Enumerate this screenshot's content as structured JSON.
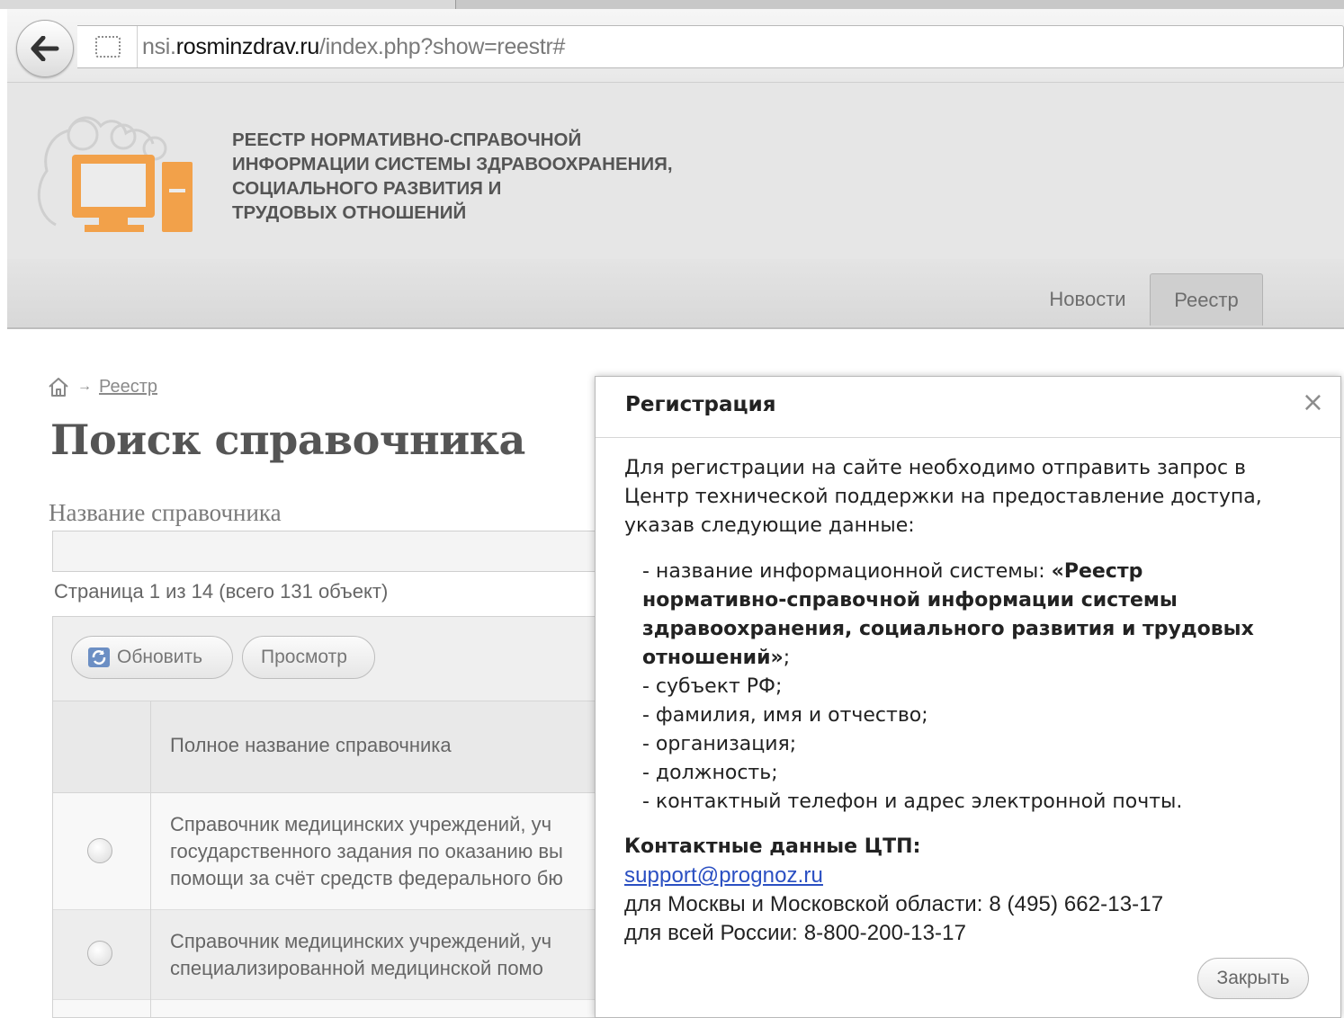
{
  "browser": {
    "url_prefix": "nsi.",
    "url_domain": "rosminzdrav.ru",
    "url_path": "/index.php?show=reestr#"
  },
  "site": {
    "title_lines": [
      "РЕЕСТР НОРМАТИВНО-СПРАВОЧНОЙ",
      "ИНФОРМАЦИИ СИСТЕМЫ ЗДРАВООХРАНЕНИЯ,",
      "СОЦИАЛЬНОГО РАЗВИТИЯ И",
      "ТРУДОВЫХ ОТНОШЕНИЙ"
    ],
    "nav": [
      "Новости",
      "Реестр"
    ]
  },
  "page": {
    "breadcrumb_current": "Реестр",
    "title": "Поиск справочника",
    "search_label": "Название справочника",
    "search_value": "",
    "pager_info": "Страница 1 из 14 (всего 131 объект)",
    "toolbar": {
      "refresh_label": "Обновить",
      "view_label": "Просмотр"
    },
    "table": {
      "column": "Полное название справочника",
      "rows": [
        [
          "Справочник медицинских учреждений, уч",
          "государственного задания по оказанию вы",
          "помощи за счёт средств федерального бю"
        ],
        [
          "Справочник медицинских учреждений, уч",
          "специализированной медицинской помо"
        ]
      ]
    }
  },
  "modal": {
    "title": "Регистрация",
    "close_glyph": "×",
    "intro_lines": [
      "Для регистрации на сайте необходимо отправить запрос в",
      "Центр технической поддержки на предоставление доступа,",
      "указав следующие данные:"
    ],
    "system_prefix": "- название информационной системы: ",
    "system_name_lines": [
      "«Реестр",
      "нормативно-справочной информации системы",
      "здравоохранения, социального развития и трудовых",
      "отношений»"
    ],
    "system_suffix": ";",
    "items": [
      "- субъект РФ;",
      "- фамилия, имя и отчество;",
      "- организация;",
      "- должность;",
      "- контактный телефон и адрес электронной почты."
    ],
    "contacts_title": "Контактные данные ЦТП:",
    "email": "support@prognoz.ru",
    "phone_moscow": "для Москвы и Московской области: 8 (495) 662-13-17",
    "phone_russia": "для всей России: 8-800-200-13-17",
    "close_button": "Закрыть"
  }
}
